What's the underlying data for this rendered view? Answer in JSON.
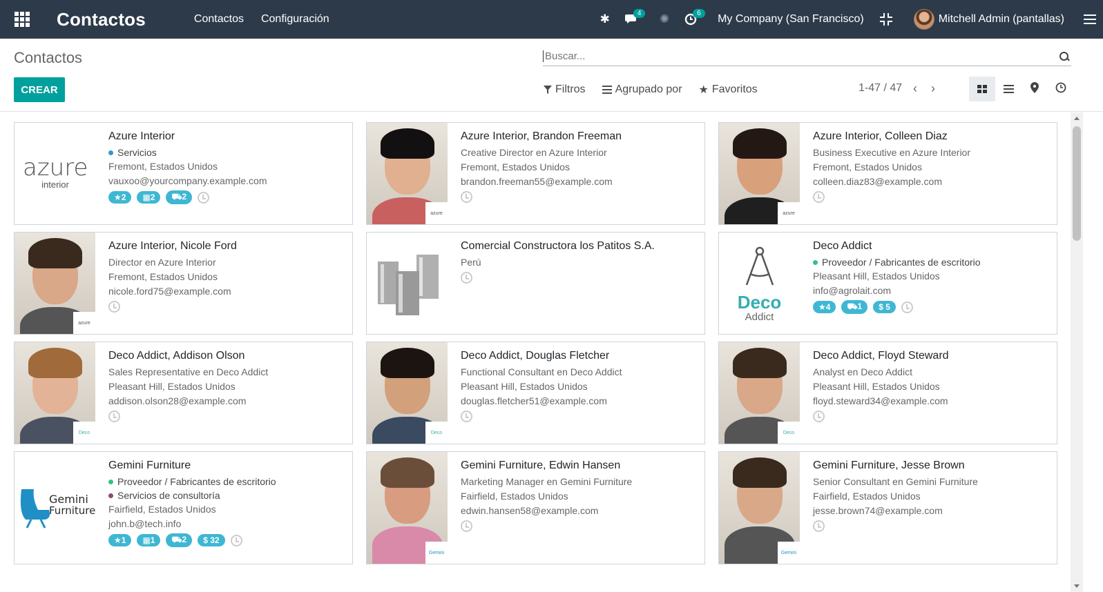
{
  "navbar": {
    "app_title": "Contactos",
    "menu": [
      "Contactos",
      "Configuración"
    ],
    "messages_count": "4",
    "activities_count": "6",
    "company": "My Company (San Francisco)",
    "user": "Mitchell Admin (pantallas)"
  },
  "control_panel": {
    "title": "Contactos",
    "search_placeholder": "Buscar...",
    "create_label": "CREAR",
    "filters_label": "Filtros",
    "groupby_label": "Agrupado por",
    "favorites_label": "Favoritos",
    "pager": "1-47 / 47"
  },
  "cards": [
    {
      "name": "Azure Interior",
      "tags": [
        {
          "label": "Servicios",
          "color": "#3597c7"
        }
      ],
      "lines": [
        "Fremont, Estados Unidos",
        "vauxoo@yourcompany.example.com"
      ],
      "pills": [
        "★2",
        "▦2",
        "⛟2"
      ],
      "image": "azure-logo"
    },
    {
      "name": "Azure Interior, Brandon Freeman",
      "tags": [],
      "lines": [
        "Creative Director en Azure Interior",
        "Fremont, Estados Unidos",
        "brandon.freeman55@example.com"
      ],
      "pills": [],
      "image": "photo"
    },
    {
      "name": "Azure Interior, Colleen Diaz",
      "tags": [],
      "lines": [
        "Business Executive en Azure Interior",
        "Fremont, Estados Unidos",
        "colleen.diaz83@example.com"
      ],
      "pills": [],
      "image": "photo"
    },
    {
      "name": "Azure Interior, Nicole Ford",
      "tags": [],
      "lines": [
        "Director en Azure Interior",
        "Fremont, Estados Unidos",
        "nicole.ford75@example.com"
      ],
      "pills": [],
      "image": "photo"
    },
    {
      "name": "Comercial Constructora los Patitos S.A.",
      "tags": [],
      "lines": [
        "Perú"
      ],
      "pills": [],
      "image": "buildings"
    },
    {
      "name": "Deco Addict",
      "tags": [
        {
          "label": "Proveedor / Fabricantes de escritorio",
          "color": "#30c381"
        }
      ],
      "lines": [
        "Pleasant Hill, Estados Unidos",
        "info@agrolait.com"
      ],
      "pills": [
        "★4",
        "⛟1",
        "$ 5"
      ],
      "image": "deco-logo"
    },
    {
      "name": "Deco Addict, Addison Olson",
      "tags": [],
      "lines": [
        "Sales Representative en Deco Addict",
        "Pleasant Hill, Estados Unidos",
        "addison.olson28@example.com"
      ],
      "pills": [],
      "image": "photo"
    },
    {
      "name": "Deco Addict, Douglas Fletcher",
      "tags": [],
      "lines": [
        "Functional Consultant en Deco Addict",
        "Pleasant Hill, Estados Unidos",
        "douglas.fletcher51@example.com"
      ],
      "pills": [],
      "image": "photo"
    },
    {
      "name": "Deco Addict, Floyd Steward",
      "tags": [],
      "lines": [
        "Analyst en Deco Addict",
        "Pleasant Hill, Estados Unidos",
        "floyd.steward34@example.com"
      ],
      "pills": [],
      "image": "photo"
    },
    {
      "name": "Gemini Furniture",
      "tags": [
        {
          "label": "Proveedor / Fabricantes de escritorio",
          "color": "#30c381"
        },
        {
          "label": "Servicios de consultoría",
          "color": "#8e4a6e"
        }
      ],
      "lines": [
        "Fairfield, Estados Unidos",
        "john.b@tech.info"
      ],
      "pills": [
        "★1",
        "▦1",
        "⛟2",
        "$ 32"
      ],
      "image": "gemini-logo"
    },
    {
      "name": "Gemini Furniture, Edwin Hansen",
      "tags": [],
      "lines": [
        "Marketing Manager en Gemini Furniture",
        "Fairfield, Estados Unidos",
        "edwin.hansen58@example.com"
      ],
      "pills": [],
      "image": "photo"
    },
    {
      "name": "Gemini Furniture, Jesse Brown",
      "tags": [],
      "lines": [
        "Senior Consultant en Gemini Furniture",
        "Fairfield, Estados Unidos",
        "jesse.brown74@example.com"
      ],
      "pills": [],
      "image": "photo"
    }
  ],
  "logos": {
    "azure_word": "azure",
    "azure_sub": "interior",
    "deco_word": "Deco",
    "deco_sub": "Addict",
    "gemini_word": "Gemini",
    "gemini_sub": "Furniture"
  }
}
